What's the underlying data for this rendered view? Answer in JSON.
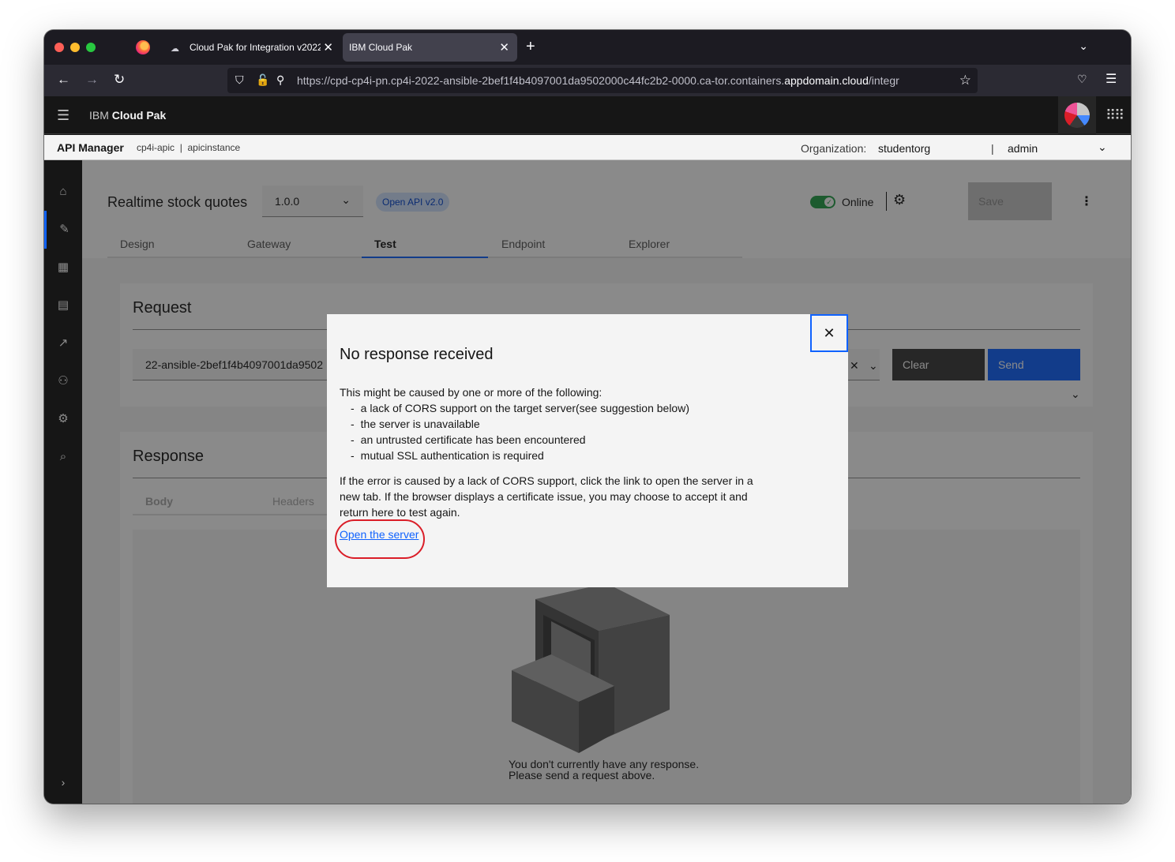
{
  "browser": {
    "tabs": [
      {
        "label": "Cloud Pak for Integration v2022",
        "active": false
      },
      {
        "label": "IBM Cloud Pak",
        "active": true
      }
    ],
    "url_prefix": "https://cpd-cp4i-pn.cp4i-2022-ansible-2bef1f4b4097001da9502000c44fc2b2-0000.ca-tor.containers.",
    "url_host": "appdomain.cloud",
    "url_suffix": "/integr"
  },
  "app_header": {
    "brand_prefix": "IBM",
    "brand_name": "Cloud Pak"
  },
  "sub_header": {
    "product": "API Manager",
    "crumb": "cp4i-apic  |  apicinstance",
    "org_label": "Organization:",
    "org": "studentorg",
    "separator": "|",
    "user": "admin"
  },
  "api": {
    "title": "Realtime stock quotes",
    "version": "1.0.0",
    "tag": "Open API v2.0",
    "online_label": "Online",
    "online": true,
    "save_label": "Save"
  },
  "tabs": [
    {
      "label": "Design"
    },
    {
      "label": "Gateway"
    },
    {
      "label": "Test",
      "active": true
    },
    {
      "label": "Endpoint"
    },
    {
      "label": "Explorer"
    }
  ],
  "request": {
    "title": "Request",
    "url_value": "22-ansible-2bef1f4b4097001da9502",
    "clear_label": "Clear",
    "send_label": "Send"
  },
  "response": {
    "title": "Response",
    "tabs": [
      "Body",
      "Headers"
    ],
    "empty_line1": "You don't currently have any response.",
    "empty_line2": "Please send a request above."
  },
  "modal": {
    "title": "No response received",
    "intro": "This might be caused by one or more of the following:",
    "causes": [
      "a lack of CORS support on the target server(see suggestion below)",
      "the server is unavailable",
      "an untrusted certificate has been encountered",
      "mutual SSL authentication is required"
    ],
    "paragraph": "If the error is caused by a lack of CORS support, click the link to open the server in a new tab. If the browser displays a certificate issue, you may choose to accept it and return here to test again.",
    "link_label": "Open the server",
    "close_glyph": "✕"
  },
  "colors": {
    "accent": "#0f62fe",
    "online": "#24a148",
    "annotation": "#da1e28"
  }
}
